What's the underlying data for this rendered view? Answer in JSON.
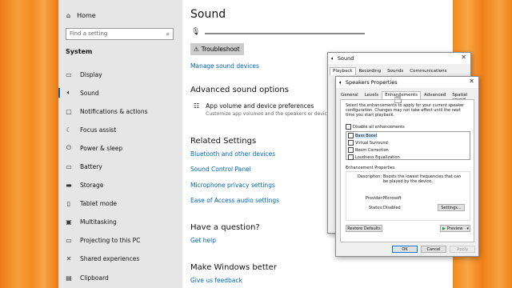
{
  "nav": {
    "home": "Home",
    "search_placeholder": "Find a setting",
    "section": "System",
    "items": [
      {
        "label": "Display",
        "icon": "display-icon"
      },
      {
        "label": "Sound",
        "icon": "speaker-icon",
        "active": true
      },
      {
        "label": "Notifications & actions",
        "icon": "notifications-icon"
      },
      {
        "label": "Focus assist",
        "icon": "moon-icon"
      },
      {
        "label": "Power & sleep",
        "icon": "power-icon"
      },
      {
        "label": "Battery",
        "icon": "battery-icon"
      },
      {
        "label": "Storage",
        "icon": "storage-icon"
      },
      {
        "label": "Tablet mode",
        "icon": "tablet-icon"
      },
      {
        "label": "Multitasking",
        "icon": "multitasking-icon"
      },
      {
        "label": "Projecting to this PC",
        "icon": "projector-icon"
      },
      {
        "label": "Shared experiences",
        "icon": "shared-icon"
      },
      {
        "label": "Clipboard",
        "icon": "clipboard-icon"
      }
    ]
  },
  "main": {
    "title": "Sound",
    "troubleshoot": "Troubleshoot",
    "manage_devices": "Manage sound devices",
    "advanced_heading": "Advanced sound options",
    "app_volume_title": "App volume and device preferences",
    "app_volume_desc": "Customize app volumes and the speakers or devices t",
    "related_heading": "Related Settings",
    "related_links": [
      "Bluetooth and other devices",
      "Sound Control Panel",
      "Microphone privacy settings",
      "Ease of Access audio settings"
    ],
    "question_heading": "Have a question?",
    "get_help": "Get help",
    "better_heading": "Make Windows better",
    "feedback": "Give us feedback"
  },
  "sound_dialog": {
    "title": "Sound",
    "tabs": [
      "Playback",
      "Recording",
      "Sounds",
      "Communications"
    ]
  },
  "speakers_dialog": {
    "title": "Speakers Properties",
    "tabs": [
      "General",
      "Levels",
      "Enhancements",
      "Advanced",
      "Spatial sound"
    ],
    "selected_tab": "Enhancements",
    "intro": "Select the enhancements to apply for your current speaker configuration. Changes may not take effect until the next time you start playback.",
    "disable_all": "Disable all enhancements",
    "enhancements": [
      "Bass Boost",
      "Virtual Surround",
      "Room Correction",
      "Loudness Equalization"
    ],
    "properties_heading": "Enhancement Properties",
    "description_label": "Description:",
    "description_text": "Boosts the lowest frequencies that can be played by the device.",
    "provider_label": "Provider:",
    "provider_value": "Microsoft",
    "status_label": "Status:",
    "status_value": "Disabled",
    "settings_btn": "Settings...",
    "restore_btn": "Restore Defaults",
    "preview_btn": "Preview",
    "ok": "OK",
    "cancel": "Cancel",
    "apply": "Apply"
  }
}
